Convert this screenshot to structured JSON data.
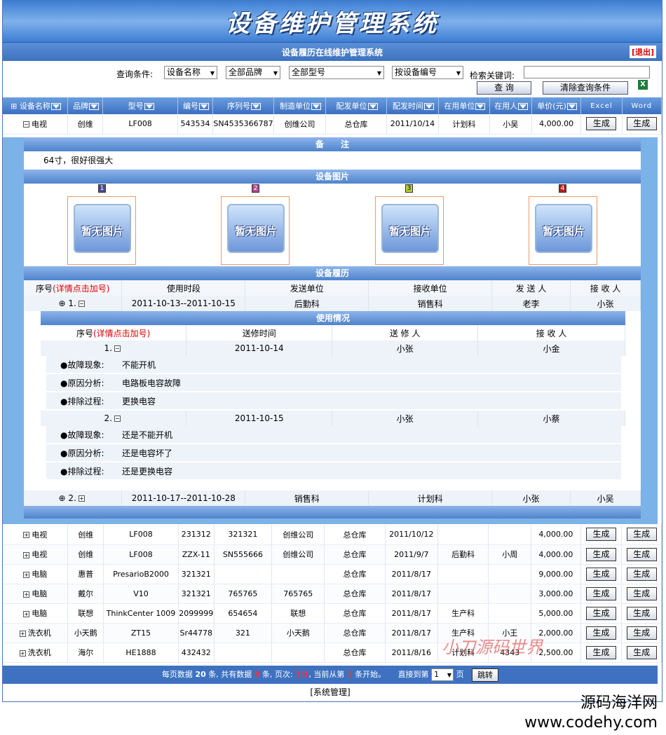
{
  "app": {
    "title": "设备维护管理系统",
    "subtitle": "设备履历在线维护管理系统",
    "logout": "[退出]"
  },
  "query": {
    "label": "查询条件:",
    "sel1": "设备名称",
    "sel2": "全部品牌",
    "sel3": "全部型号",
    "sel4": "按设备编号",
    "kw_label": "检索关键词:",
    "search": "查 询",
    "clear": "清除查询条件"
  },
  "headers": [
    "设备名称",
    "品牌",
    "型号",
    "编号",
    "序列号",
    "制造单位",
    "配发单位",
    "配发时间",
    "在用单位",
    "在用人",
    "单价(元)",
    "Excel",
    "Word"
  ],
  "gen": "生成",
  "row0": [
    "电视",
    "创维",
    "LF008",
    "543534",
    "SN4535366787",
    "创维公司",
    "总仓库",
    "2011/10/14",
    "计划科",
    "小吴",
    "4,000.00"
  ],
  "detail": {
    "notes_title": "备　　注",
    "notes": "64寸，很好很强大",
    "pics_title": "设备图片",
    "no_pic": "暂无图片",
    "pic_nums": [
      "1",
      "2",
      "3",
      "4"
    ],
    "pic_colors": [
      "#4b4b8f",
      "#b04a8c",
      "#b0d040",
      "#b02020"
    ],
    "hist_title": "设备履历",
    "hist_head": [
      "序号",
      "(详情点击加号)",
      "使用时段",
      "发送单位",
      "接收单位",
      "发 送 人",
      "接 收 人"
    ],
    "hist1": [
      "1.",
      "2011-10-13--2011-10-15",
      "后勤科",
      "销售科",
      "老李",
      "小张"
    ],
    "usage_title": "使用情况",
    "usage_head": [
      "序号",
      "(详情点击加号)",
      "送修时间",
      "送 修 人",
      "接 收 人"
    ],
    "u1": [
      "1.",
      "2011-10-14",
      "小张",
      "小金"
    ],
    "u1f": [
      [
        "●故障现象:",
        "不能开机"
      ],
      [
        "●原因分析:",
        "电路板电容故障"
      ],
      [
        "●排除过程:",
        "更换电容"
      ]
    ],
    "u2": [
      "2.",
      "2011-10-15",
      "小张",
      "小蔡"
    ],
    "u2f": [
      [
        "●故障现象:",
        "还是不能开机"
      ],
      [
        "●原因分析:",
        "还是电容坏了"
      ],
      [
        "●排除过程:",
        "还是更换电容"
      ]
    ],
    "hist2": [
      "2.",
      "2011-10-17--2011-10-28",
      "销售科",
      "计划科",
      "小张",
      "小吴"
    ]
  },
  "rows": [
    [
      "电视",
      "创维",
      "LF008",
      "231312",
      "321321",
      "创维公司",
      "总仓库",
      "2011/10/12",
      "",
      "",
      "4,000.00"
    ],
    [
      "电视",
      "创维",
      "LF008",
      "ZZX-11",
      "SN555666",
      "创维公司",
      "总仓库",
      "2011/9/7",
      "后勤科",
      "小周",
      "4,000.00"
    ],
    [
      "电脑",
      "惠普",
      "PresarioB2000",
      "321321",
      "",
      "",
      "总仓库",
      "2011/8/17",
      "",
      "",
      "9,000.00"
    ],
    [
      "电脑",
      "戴尔",
      "V10",
      "321321",
      "765765",
      "765765",
      "总仓库",
      "2011/8/17",
      "",
      "",
      "3,000.00"
    ],
    [
      "电脑",
      "联想",
      "ThinkCenter 1009",
      "2099999",
      "654654",
      "联想",
      "总仓库",
      "2011/8/17",
      "生产科",
      "",
      "5,000.00"
    ],
    [
      "洗衣机",
      "小天鹅",
      "ZT15",
      "Sr44778",
      "321",
      "小天鹅",
      "总仓库",
      "2011/8/17",
      "生产科",
      "小王",
      "2,000.00"
    ],
    [
      "洗衣机",
      "海尔",
      "HE1888",
      "432432",
      "",
      "",
      "总仓库",
      "2011/8/16",
      "计划科",
      "4343",
      "2,500.00"
    ]
  ],
  "pager": {
    "t1": "每页数据",
    "n1": "20",
    "t2": "条, 共有数据",
    "n2": "8",
    "t3": "条, 页次:",
    "n3": "1/1",
    "t4": ", 当前从第",
    "n4": "1",
    "t5": "条开始。",
    "t6": "直接到第",
    "page": "1",
    "t7": "页",
    "jump": "跳转"
  },
  "footer": "[系统管理]",
  "watermark": "小刀源码世界",
  "brand": {
    "l1": "源码海洋网",
    "l2": "www.codehy.com"
  }
}
